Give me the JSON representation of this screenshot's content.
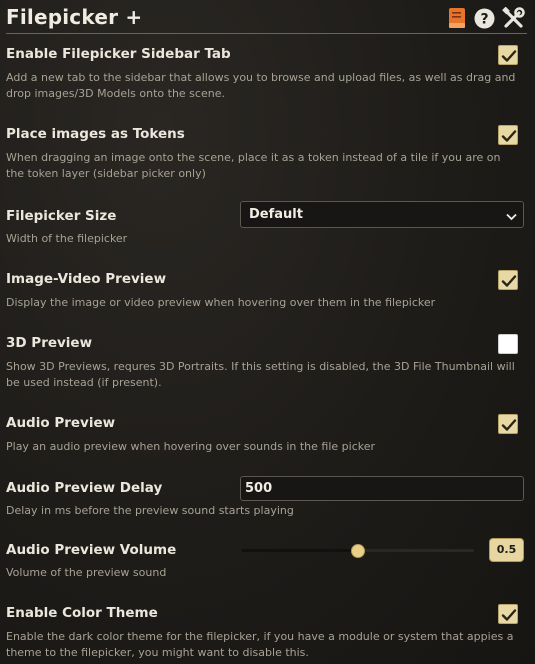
{
  "header": {
    "title": "Filepicker +",
    "icons": [
      "book-icon",
      "help-icon",
      "tools-icon"
    ]
  },
  "settings": [
    {
      "label": "Enable Filepicker Sidebar Tab",
      "hint": "Add a new tab to the sidebar that allows you to browse and upload files, as well as drag and drop images/3D Models onto the scene.",
      "control": "checkbox",
      "checked": true
    },
    {
      "label": "Place images as Tokens",
      "hint": "When dragging an image onto the scene, place it as a token instead of a tile if you are on the token layer (sidebar picker only)",
      "control": "checkbox",
      "checked": true
    },
    {
      "label": "Filepicker Size",
      "hint": "Width of the filepicker",
      "control": "select",
      "value": "Default"
    },
    {
      "label": "Image-Video Preview",
      "hint": "Display the image or video preview when hovering over them in the filepicker",
      "control": "checkbox",
      "checked": true
    },
    {
      "label": "3D Preview",
      "hint": "Show 3D Previews, requres 3D Portraits. If this setting is disabled, the 3D File Thumbnail will be used instead (if present).",
      "control": "checkbox",
      "checked": false
    },
    {
      "label": "Audio Preview",
      "hint": "Play an audio preview when hovering over sounds in the file picker",
      "control": "checkbox",
      "checked": true
    },
    {
      "label": "Audio Preview Delay",
      "hint": "Delay in ms before the preview sound starts playing",
      "control": "number",
      "value": "500"
    },
    {
      "label": "Audio Preview Volume",
      "hint": "Volume of the preview sound",
      "control": "range",
      "value": "0.5",
      "fraction": 0.5
    },
    {
      "label": "Enable Color Theme",
      "hint": "Enable the dark color theme for the filepicker, if you have a module or system that appies a theme to the filepicker, you might want to disable this.",
      "control": "checkbox",
      "checked": true
    }
  ],
  "colors": {
    "accent_line": "#b5472e",
    "checkbox_checked": "#e8d8a3",
    "book_icon": "#e8732a"
  }
}
